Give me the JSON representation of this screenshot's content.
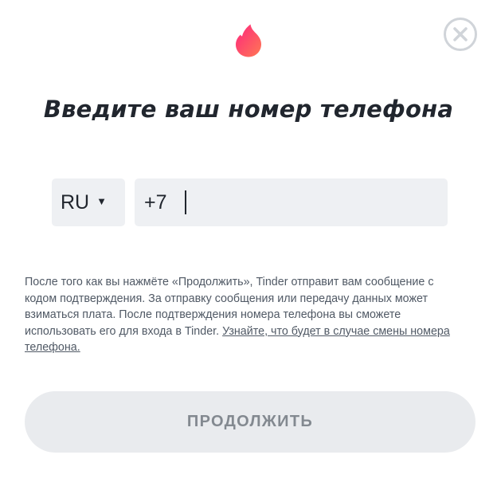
{
  "icons": {
    "logo": "tinder-flame-icon",
    "close": "close-circle-icon",
    "dropdown": "caret-down-icon"
  },
  "colors": {
    "brand_gradient_start": "#fe3c72",
    "brand_gradient_end": "#ff6036",
    "title_text": "#21262e",
    "field_background": "#eef0f3",
    "button_background": "#e9ebee",
    "button_text": "#838990",
    "close_icon": "#d0d4d9"
  },
  "title": "Введите ваш номер телефона",
  "country_select": {
    "value": "RU",
    "caret": "▼"
  },
  "phone_input": {
    "prefix": "+7",
    "value": ""
  },
  "disclaimer": {
    "text": "После того как вы нажмёте «Продолжить», Tinder отправит вам сообщение с кодом подтверждения. За отправку сообщения или передачу данных может взиматься плата. После подтверждения номера телефона вы сможете использовать его для входа в Tinder. ",
    "link": "Узнайте, что будет в случае смены номера телефона."
  },
  "continue_button": {
    "label": "ПРОДОЛЖИТЬ"
  }
}
